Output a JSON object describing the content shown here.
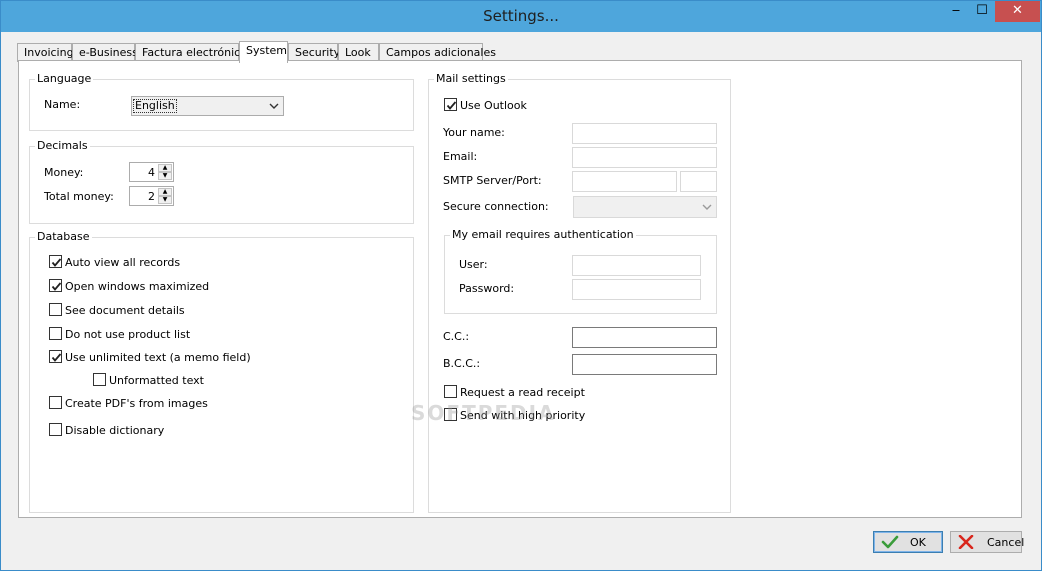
{
  "window": {
    "title": "Settings...",
    "minimize_glyph": "‒",
    "maximize_glyph": "☐",
    "close_glyph": "✕"
  },
  "tabs": [
    {
      "label": "Invoicing"
    },
    {
      "label": "e-Business"
    },
    {
      "label": "Factura electrónica"
    },
    {
      "label": "System",
      "active": true
    },
    {
      "label": "Security"
    },
    {
      "label": "Look"
    },
    {
      "label": "Campos adicionales"
    }
  ],
  "language": {
    "group_title": "Language",
    "name_label": "Name:",
    "name_value": "English"
  },
  "decimals": {
    "group_title": "Decimals",
    "money_label": "Money:",
    "money_value": "4",
    "total_money_label": "Total money:",
    "total_money_value": "2"
  },
  "database": {
    "group_title": "Database",
    "options": [
      {
        "label": "Auto view all records",
        "checked": true
      },
      {
        "label": "Open windows maximized",
        "checked": true
      },
      {
        "label": "See document details",
        "checked": false
      },
      {
        "label": "Do not use product list",
        "checked": false
      },
      {
        "label": "Use unlimited text (a memo field)",
        "checked": true
      },
      {
        "label": "Unformatted text",
        "checked": false
      },
      {
        "label": "Create PDF's from images",
        "checked": false
      },
      {
        "label": "Disable dictionary",
        "checked": false
      }
    ]
  },
  "mail": {
    "group_title": "Mail settings",
    "use_outlook_label": "Use Outlook",
    "use_outlook_checked": true,
    "your_name_label": "Your name:",
    "your_name_value": "",
    "email_label": "Email:",
    "email_value": "",
    "smtp_label": "SMTP Server/Port:",
    "smtp_server_value": "",
    "smtp_port_value": "",
    "secure_label": "Secure connection:",
    "secure_value": "",
    "auth": {
      "group_title": "My email requires authentication",
      "user_label": "User:",
      "user_value": "",
      "password_label": "Password:",
      "password_value": ""
    },
    "cc_label": "C.C.:",
    "cc_value": "",
    "bcc_label": "B.C.C.:",
    "bcc_value": "",
    "read_receipt_label": "Request a read receipt",
    "read_receipt_checked": false,
    "high_priority_label": "Send with high priority",
    "high_priority_checked": false
  },
  "footer": {
    "ok_label": "OK",
    "cancel_label": "Cancel",
    "ok_icon": "checkmark-icon",
    "cancel_icon": "red-x-icon",
    "ok_icon_color": "#3a9c3a",
    "cancel_icon_color": "#d9261c"
  },
  "watermark": "SOFTPEDIA"
}
